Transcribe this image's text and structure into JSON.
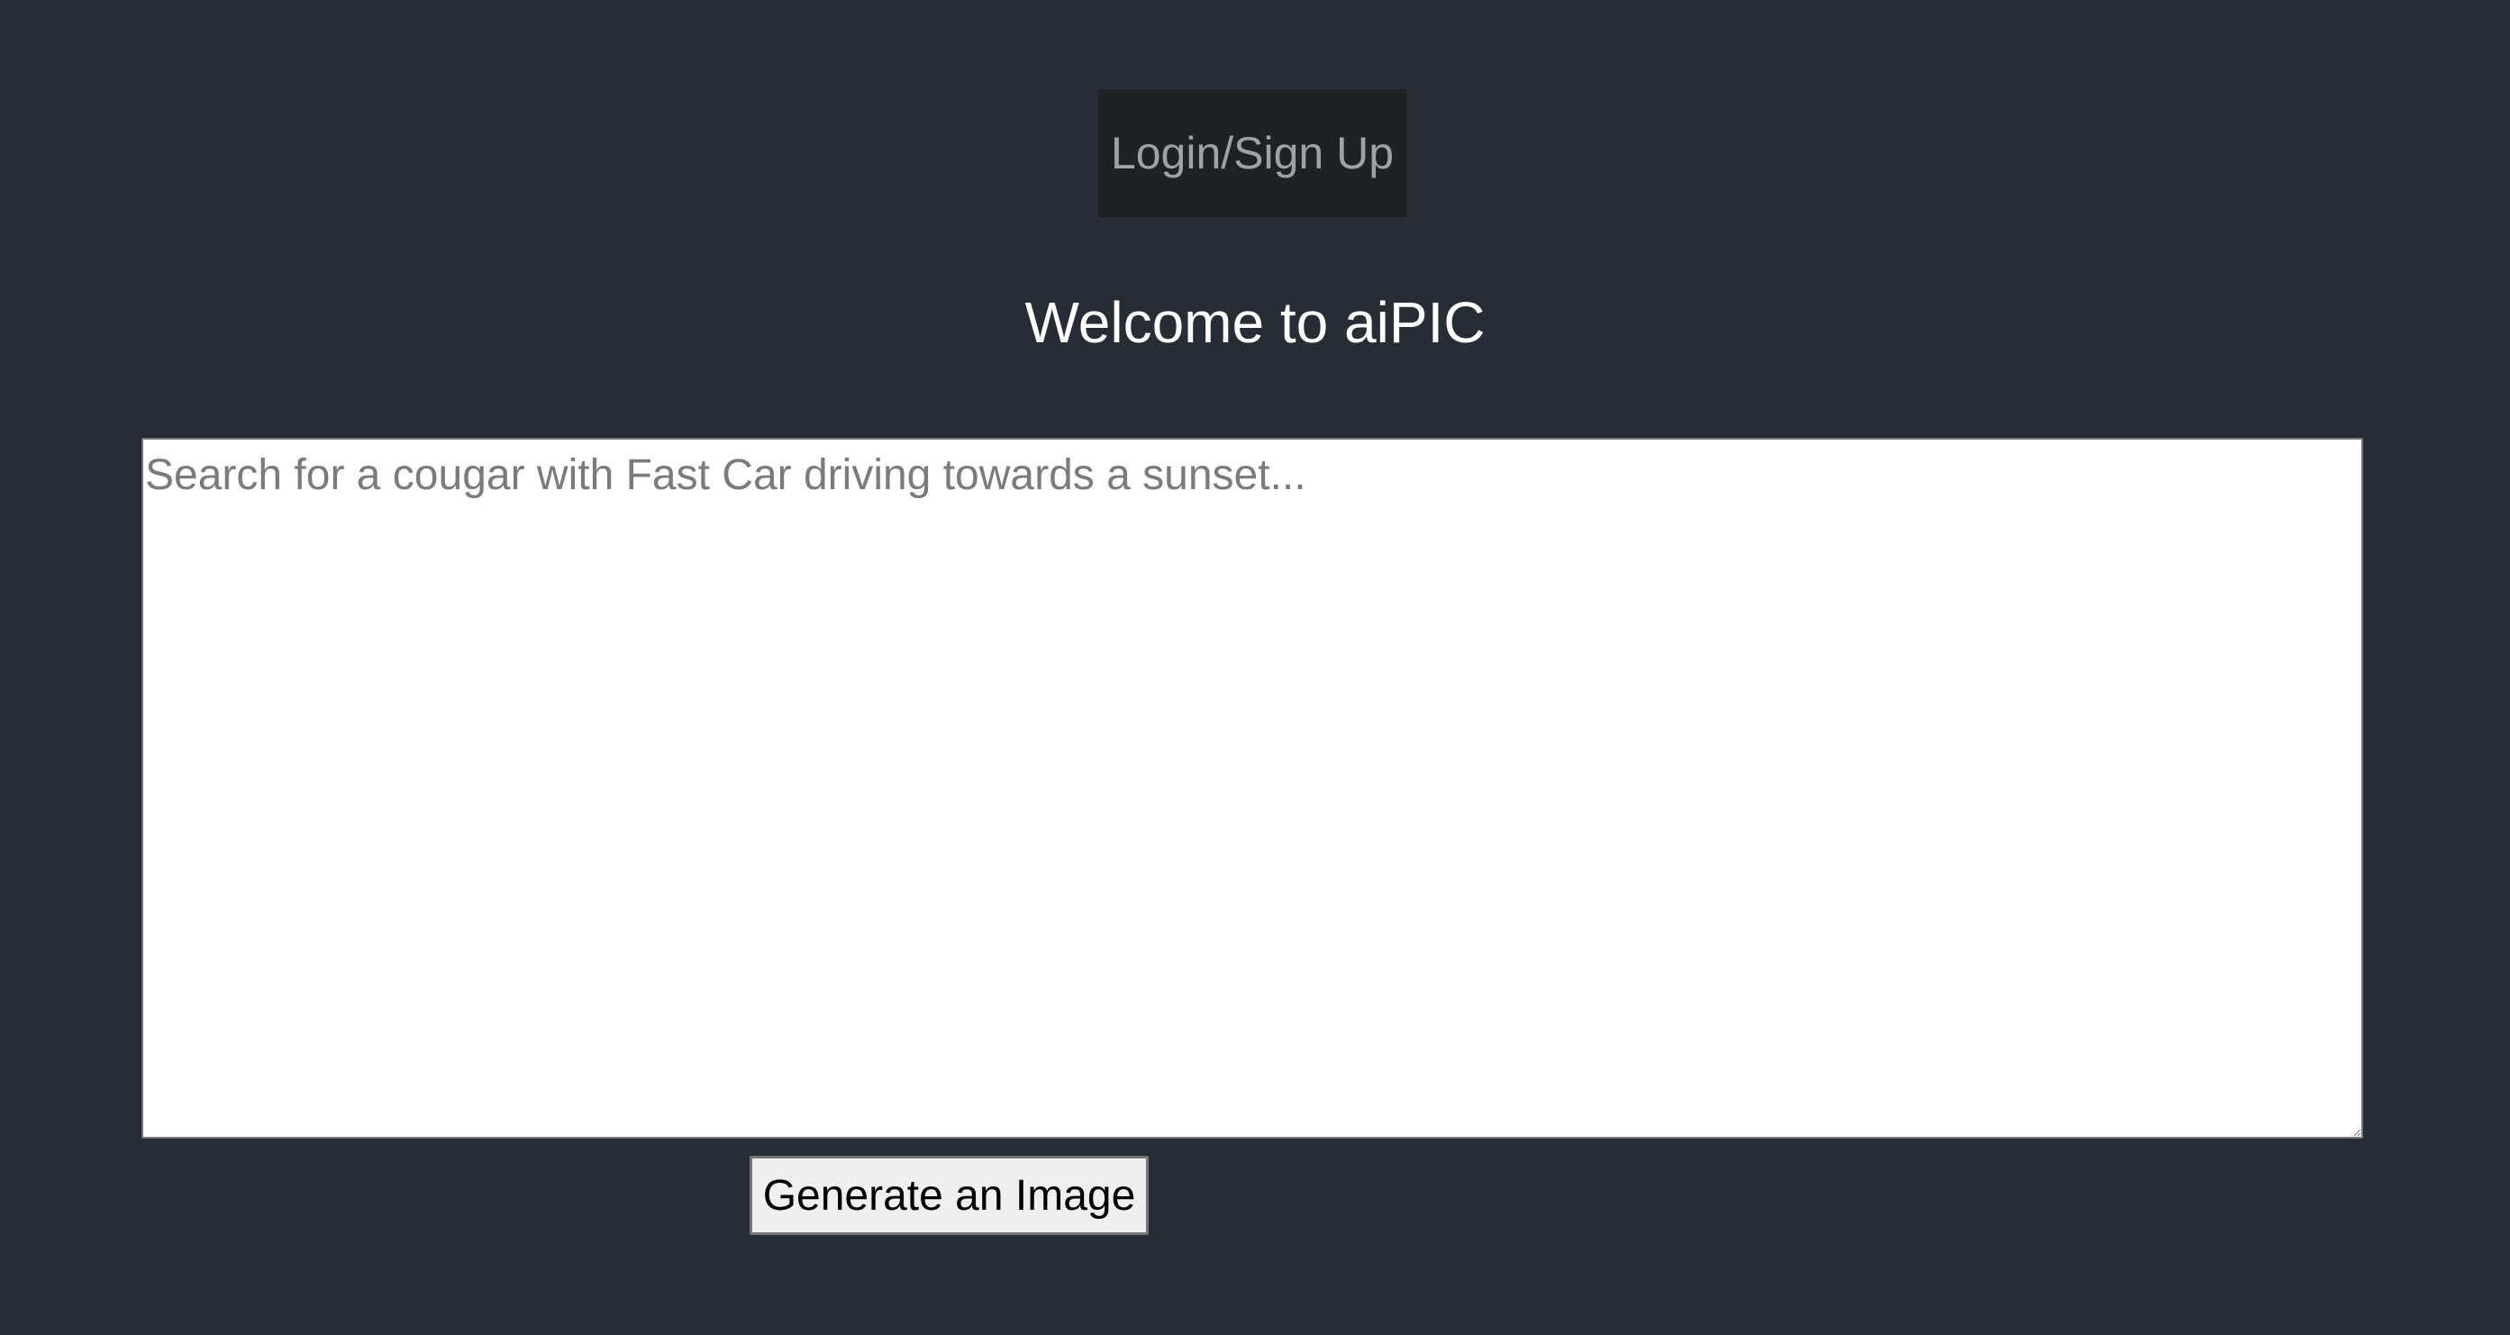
{
  "header": {
    "login_label": "Login/Sign Up"
  },
  "main": {
    "title": "Welcome to aiPIC",
    "prompt_placeholder": "Search for a cougar with Fast Car driving towards a sunset...",
    "prompt_value": "",
    "generate_label": "Generate an Image"
  },
  "colors": {
    "background": "#282c34",
    "login_button_bg": "#1f2124",
    "login_button_text": "#9ea1a6",
    "title_text": "#ffffff",
    "textarea_bg": "#ffffff",
    "button_bg": "#efefef"
  }
}
